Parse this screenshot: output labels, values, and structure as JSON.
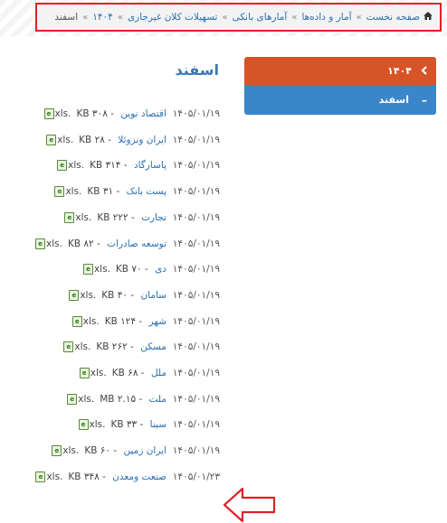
{
  "breadcrumb": {
    "home": "صفحه نخست",
    "items": [
      "آمار و داده‌ها",
      "آمارهای بانکی",
      "تسهیلات کلان غیرجاری",
      "۱۴۰۴"
    ],
    "current": "اسفند",
    "separator": "»"
  },
  "sidebar": {
    "parent_label": "۱۴۰۴",
    "child_label": "اسفند",
    "colors": {
      "parent": "#d65428",
      "child": "#3a86c8"
    }
  },
  "page_title": "اسفند",
  "files": [
    {
      "name": "اقتصاد نوین",
      "size": "KB ۳۰۸",
      "ext": ".xls",
      "date": "۱۴۰۵/۰۱/۱۹"
    },
    {
      "name": "ایران ونزوئلا",
      "size": "KB ۲۸",
      "ext": ".xls",
      "date": "۱۴۰۵/۰۱/۱۹"
    },
    {
      "name": "پاسارگاد",
      "size": "KB ۳۱۴",
      "ext": ".xls",
      "date": "۱۴۰۵/۰۱/۱۹"
    },
    {
      "name": "پست بانک",
      "size": "KB ۳۱",
      "ext": ".xls",
      "date": "۱۴۰۵/۰۱/۱۹"
    },
    {
      "name": "تجارت",
      "size": "KB ۲۲۲",
      "ext": ".xls",
      "date": "۱۴۰۵/۰۱/۱۹"
    },
    {
      "name": "توسعه صادرات",
      "size": "KB ۸۲",
      "ext": ".xls",
      "date": "۱۴۰۵/۰۱/۱۹"
    },
    {
      "name": "دی",
      "size": "KB ۷۰",
      "ext": ".xls",
      "date": "۱۴۰۵/۰۱/۱۹"
    },
    {
      "name": "سامان",
      "size": "KB ۴۰",
      "ext": ".xls",
      "date": "۱۴۰۵/۰۱/۱۹"
    },
    {
      "name": "شهر",
      "size": "KB ۱۲۴",
      "ext": ".xls",
      "date": "۱۴۰۵/۰۱/۱۹"
    },
    {
      "name": "مسکن",
      "size": "KB ۲۶۲",
      "ext": ".xls",
      "date": "۱۴۰۵/۰۱/۱۹"
    },
    {
      "name": "ملل",
      "size": "KB ۶۸",
      "ext": ".xls",
      "date": "۱۴۰۵/۰۱/۱۹"
    },
    {
      "name": "ملت",
      "size": "MB ۲.۱۵",
      "ext": ".xls",
      "date": "۱۴۰۵/۰۱/۱۹"
    },
    {
      "name": "سینا",
      "size": "KB ۳۳",
      "ext": ".xls",
      "date": "۱۴۰۵/۰۱/۱۹"
    },
    {
      "name": "ایران زمین",
      "size": "KB ۶۰",
      "ext": ".xls",
      "date": "۱۴۰۵/۰۱/۱۹"
    },
    {
      "name": "صنعت ومعدن",
      "size": "KB ۳۴۸",
      "ext": ".xls",
      "date": "۱۴۰۵/۰۱/۲۳"
    }
  ],
  "icons": {
    "home": "home-icon",
    "file": "xls-file-icon",
    "parent_chevron": "chevron-left-icon",
    "annotation": "left-arrow-outline"
  },
  "annotation_color": "#e0202a"
}
